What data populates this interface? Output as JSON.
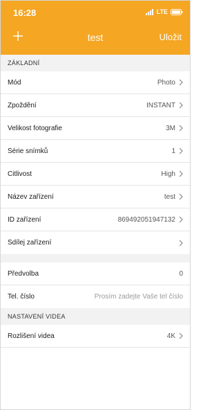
{
  "status_bar": {
    "time": "16:28",
    "network": "LTE"
  },
  "nav": {
    "add_icon": "plus-icon",
    "title": "test",
    "save_label": "Uložit"
  },
  "sections": {
    "basic": {
      "header": "ZÁKLADNÍ",
      "rows": [
        {
          "label": "Mód",
          "value": "Photo"
        },
        {
          "label": "Zpoždění",
          "value": "INSTANT"
        },
        {
          "label": "Velikost fotografie",
          "value": "3M"
        },
        {
          "label": "Série snímků",
          "value": "1"
        },
        {
          "label": "Citlivost",
          "value": "High"
        },
        {
          "label": "Název zařízení",
          "value": "test"
        },
        {
          "label": "ID zařízení",
          "value": "869492051947132"
        },
        {
          "label": "Sdílej zařízení",
          "value": ""
        }
      ]
    },
    "extra": {
      "rows": [
        {
          "label": "Předvolba",
          "value": "0"
        },
        {
          "label": "Tel. číslo",
          "placeholder": "Prosím zadejte Vaše tel číslo"
        }
      ]
    },
    "video": {
      "header": "NASTAVENÍ VIDEA",
      "rows": [
        {
          "label": "Rozlišení videa",
          "value": "4K"
        }
      ]
    }
  },
  "colors": {
    "accent": "#f5a623",
    "section_bg": "#f2f2f2"
  }
}
